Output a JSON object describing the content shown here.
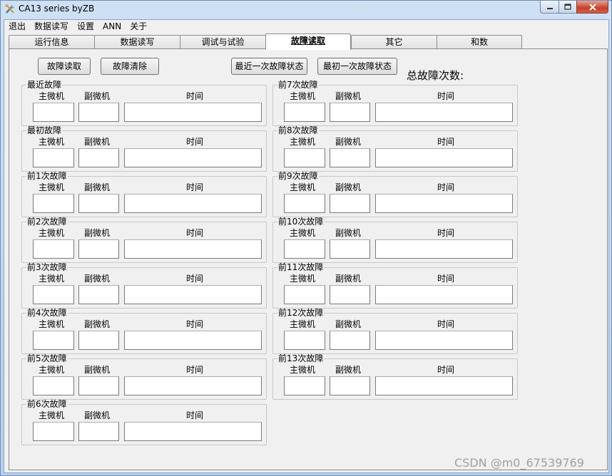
{
  "window": {
    "title": "CA13 series byZB"
  },
  "menu": [
    "退出",
    "数据读写",
    "设置",
    "ANN",
    "关于"
  ],
  "tabs": [
    "运行信息",
    "数据读写",
    "调试与试验",
    "故障读取",
    "其它",
    "和数"
  ],
  "active_tab_index": 3,
  "buttons": {
    "read": "故障读取",
    "clear": "故障清除",
    "latest": "最近一次故障状态",
    "first": "最初一次故障状态"
  },
  "total_faults_label": "总故障次数:",
  "columns": {
    "main": "主微机",
    "sub": "副微机",
    "time": "时间"
  },
  "left_groups": [
    "最近故障",
    "最初故障",
    "前1次故障",
    "前2次故障",
    "前3次故障",
    "前4次故障",
    "前5次故障",
    "前6次故障"
  ],
  "right_groups": [
    "前7次故障",
    "前8次故障",
    "前9次故障",
    "前10次故障",
    "前11次故障",
    "前12次故障",
    "前13次故障"
  ],
  "watermark": "CSDN @m0_67539769"
}
